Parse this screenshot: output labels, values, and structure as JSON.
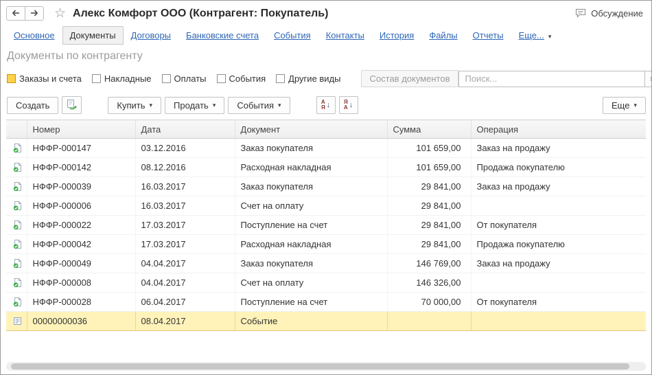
{
  "window": {
    "title": "Алекс Комфорт ООО (Контрагент: Покупатель)",
    "discussion_label": "Обсуждение"
  },
  "icons": {
    "caret_down": "▾",
    "star": "☆",
    "clear": "×",
    "sort_arrow": "↓"
  },
  "tabs": [
    {
      "key": "main",
      "label": "Основное"
    },
    {
      "key": "documents",
      "label": "Документы",
      "active": true
    },
    {
      "key": "contracts",
      "label": "Договоры"
    },
    {
      "key": "bank-accounts",
      "label": "Банковские счета"
    },
    {
      "key": "events",
      "label": "События"
    },
    {
      "key": "contacts",
      "label": "Контакты"
    },
    {
      "key": "history",
      "label": "История"
    },
    {
      "key": "files",
      "label": "Файлы"
    },
    {
      "key": "reports",
      "label": "Отчеты"
    },
    {
      "key": "more",
      "label": "Еще...",
      "dropdown": true
    }
  ],
  "page": {
    "heading": "Документы по контрагенту"
  },
  "filters": {
    "checkboxes": [
      {
        "key": "orders-and-invoices",
        "label": "Заказы и счета",
        "checked": false,
        "focused": true
      },
      {
        "key": "waybills",
        "label": "Накладные",
        "checked": false
      },
      {
        "key": "payments",
        "label": "Оплаты",
        "checked": false
      },
      {
        "key": "events",
        "label": "События",
        "checked": false
      },
      {
        "key": "other-types",
        "label": "Другие виды",
        "checked": false
      }
    ],
    "composition_button": "Состав документов",
    "search_placeholder": "Поиск..."
  },
  "toolbar": {
    "create": "Создать",
    "buy": "Купить",
    "sell": "Продать",
    "events": "События",
    "more": "Еще",
    "sort_asc": [
      "А",
      "Я"
    ],
    "sort_desc": [
      "Я",
      "А"
    ]
  },
  "table": {
    "columns": [
      "Номер",
      "Дата",
      "Документ",
      "Сумма",
      "Операция"
    ],
    "rows": [
      {
        "icon": "posted-document",
        "number": "НФФР-000147",
        "date": "03.12.2016",
        "document": "Заказ покупателя",
        "amount": "101 659,00",
        "operation": "Заказ на продажу"
      },
      {
        "icon": "posted-document",
        "number": "НФФР-000142",
        "date": "08.12.2016",
        "document": "Расходная накладная",
        "amount": "101 659,00",
        "operation": "Продажа покупателю"
      },
      {
        "icon": "posted-document",
        "number": "НФФР-000039",
        "date": "16.03.2017",
        "document": "Заказ покупателя",
        "amount": "29 841,00",
        "operation": "Заказ на продажу"
      },
      {
        "icon": "posted-document",
        "number": "НФФР-000006",
        "date": "16.03.2017",
        "document": "Счет на оплату",
        "amount": "29 841,00",
        "operation": ""
      },
      {
        "icon": "posted-document",
        "number": "НФФР-000022",
        "date": "17.03.2017",
        "document": "Поступление на счет",
        "amount": "29 841,00",
        "operation": "От покупателя"
      },
      {
        "icon": "posted-document",
        "number": "НФФР-000042",
        "date": "17.03.2017",
        "document": "Расходная накладная",
        "amount": "29 841,00",
        "operation": "Продажа покупателю"
      },
      {
        "icon": "posted-document",
        "number": "НФФР-000049",
        "date": "04.04.2017",
        "document": "Заказ покупателя",
        "amount": "146 769,00",
        "operation": "Заказ на продажу"
      },
      {
        "icon": "posted-document",
        "number": "НФФР-000008",
        "date": "04.04.2017",
        "document": "Счет на оплату",
        "amount": "146 326,00",
        "operation": ""
      },
      {
        "icon": "posted-document",
        "number": "НФФР-000028",
        "date": "06.04.2017",
        "document": "Поступление на счет",
        "amount": "70 000,00",
        "operation": "От покупателя"
      },
      {
        "icon": "event",
        "number": "00000000036",
        "date": "08.04.2017",
        "document": "Событие",
        "amount": "",
        "operation": "",
        "selected": true
      }
    ]
  }
}
